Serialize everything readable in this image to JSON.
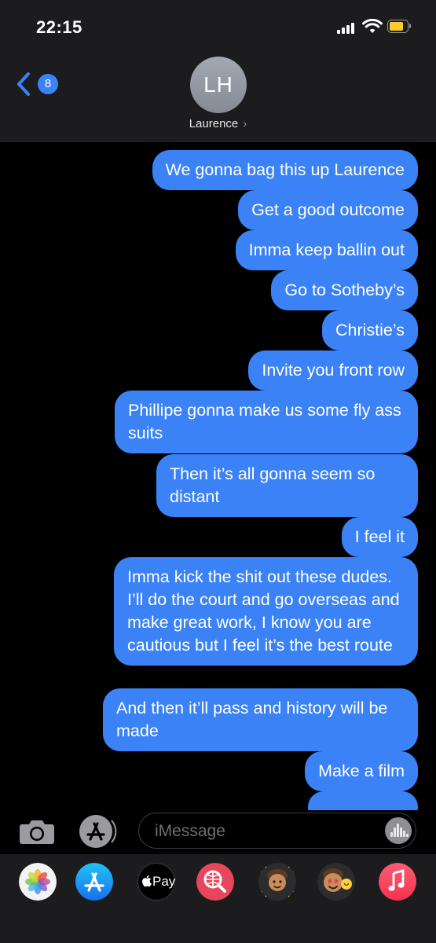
{
  "status": {
    "time": "22:15"
  },
  "header": {
    "back_badge": "8",
    "avatar_initials": "LH",
    "contact_name": "Laurence",
    "chevron": "›"
  },
  "messages": [
    "We gonna bag this up Laurence",
    "Get a good outcome",
    "Imma keep ballin out",
    "Go to Sotheby’s",
    "Christie’s",
    "Invite you front row",
    "Phillipe gonna make us some fly ass suits",
    "Then it’s all gonna seem so distant",
    "I feel it",
    "Imma kick the shit out these dudes. I’ll do the court and go overseas and make great work, I know you are cautious but I feel it’s the best route",
    "And then it’ll pass and history will be made",
    "Make a film"
  ],
  "input": {
    "placeholder": "iMessage"
  },
  "tray": {
    "applepay_label": "Pay"
  },
  "colors": {
    "bubble": "#3b82f6",
    "badge": "#3a82f7",
    "battery": "#f7cc2c"
  },
  "icons": [
    "camera-icon",
    "app-store-icon",
    "audio-message-icon",
    "photos-app-icon",
    "app-store-app-icon",
    "apple-pay-icon",
    "web-search-icon",
    "memoji-icon",
    "memoji-sticker-icon",
    "music-app-icon"
  ]
}
